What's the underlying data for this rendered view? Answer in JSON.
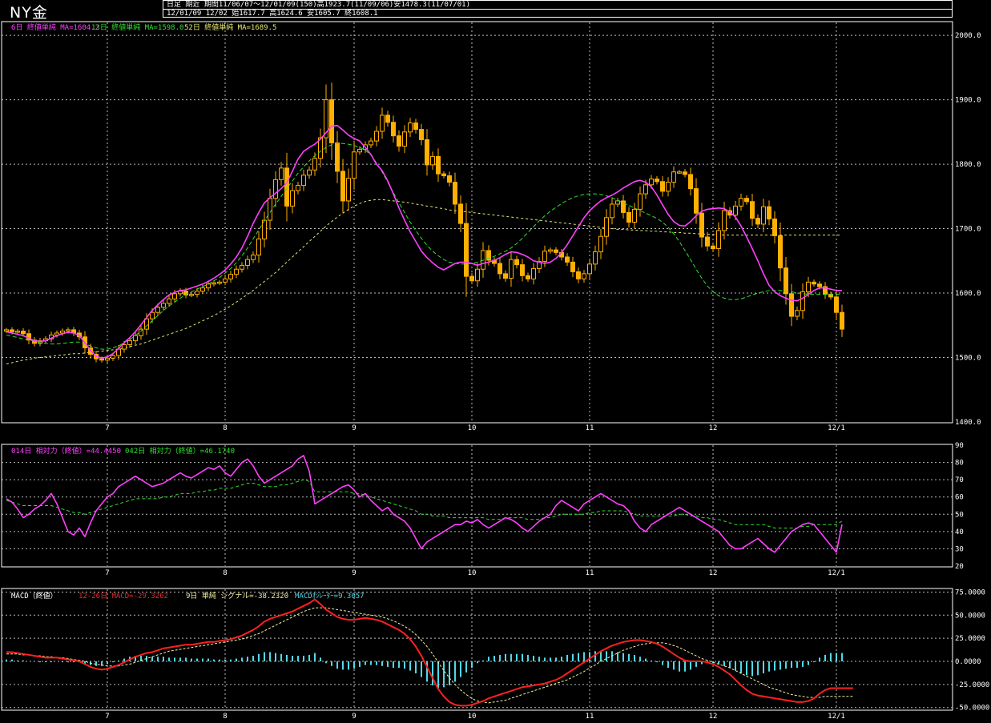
{
  "title": "NY金",
  "header": {
    "line1": "日足 期近 期間11/06/07～12/01/09(150)高1923.7(11/09/06)安1478.3(11/07/01)",
    "line2": "12/01/09 12/02 始1617.7 高1624.6 安1605.7 終1608.1"
  },
  "colors": {
    "background": "#000000",
    "grid": "#bbbbbb",
    "candle": "#ffb000",
    "ma6": "#ff40ff",
    "ma13": "#30e030",
    "ma52": "#e8e870",
    "rsi14": "#ff40ff",
    "rsi42": "#30e030",
    "macd": "#ff2020",
    "signal": "#f0f0a0",
    "osc": "#50d8e8",
    "text": "#ffffff"
  },
  "chart_data": [
    {
      "type": "candlestick",
      "legend": {
        "ma6": "6日 終値単純 MA=1604.2",
        "ma13": "13日 終値単純 MA=1598.0",
        "ma52": "52日 終値単純 MA=1689.5"
      },
      "ylim": [
        1400,
        2020
      ],
      "yticks": [
        1400,
        1500,
        1600,
        1700,
        1800,
        1900,
        2000
      ],
      "ytick_labels": [
        "1400.0",
        "1500.0",
        "1600.0",
        "1700.0",
        "1800.0",
        "1900.0",
        "2000.0"
      ],
      "x_count": 150,
      "xticks": [
        {
          "index": 18,
          "label": "7"
        },
        {
          "index": 39,
          "label": "8"
        },
        {
          "index": 62,
          "label": "9"
        },
        {
          "index": 83,
          "label": "10"
        },
        {
          "index": 104,
          "label": "11"
        },
        {
          "index": 126,
          "label": "12"
        },
        {
          "index": 148,
          "label": "12/1"
        }
      ],
      "close": [
        1543,
        1540,
        1541,
        1537,
        1527,
        1522,
        1526,
        1529,
        1535,
        1538,
        1541,
        1543,
        1538,
        1532,
        1515,
        1505,
        1498,
        1496,
        1499,
        1503,
        1513,
        1520,
        1526,
        1534,
        1544,
        1560,
        1570,
        1578,
        1584,
        1591,
        1599,
        1603,
        1597,
        1598,
        1603,
        1608,
        1614,
        1616,
        1617,
        1622,
        1629,
        1637,
        1643,
        1652,
        1659,
        1684,
        1713,
        1747,
        1776,
        1794,
        1735,
        1759,
        1767,
        1783,
        1791,
        1809,
        1841,
        1900,
        1833,
        1789,
        1743,
        1778,
        1819,
        1823,
        1830,
        1836,
        1851,
        1876,
        1865,
        1844,
        1828,
        1850,
        1864,
        1854,
        1838,
        1799,
        1812,
        1785,
        1782,
        1772,
        1738,
        1708,
        1626,
        1619,
        1637,
        1666,
        1651,
        1646,
        1630,
        1623,
        1652,
        1644,
        1627,
        1622,
        1638,
        1649,
        1665,
        1667,
        1663,
        1656,
        1648,
        1633,
        1622,
        1630,
        1645,
        1664,
        1688,
        1717,
        1738,
        1743,
        1725,
        1710,
        1730,
        1754,
        1768,
        1777,
        1773,
        1758,
        1772,
        1788,
        1788,
        1784,
        1762,
        1724,
        1687,
        1673,
        1669,
        1697,
        1728,
        1721,
        1735,
        1747,
        1742,
        1716,
        1707,
        1734,
        1715,
        1689,
        1639,
        1599,
        1564,
        1573,
        1602,
        1617,
        1614,
        1610,
        1598,
        1594,
        1570,
        1544
      ],
      "ma6": [
        1540,
        1538,
        1536,
        1534,
        1530,
        1526,
        1525,
        1526,
        1530,
        1534,
        1537,
        1539,
        1538,
        1534,
        1523,
        1511,
        1502,
        1499,
        1501,
        1506,
        1514,
        1523,
        1531,
        1540,
        1551,
        1562,
        1573,
        1582,
        1590,
        1597,
        1601,
        1604,
        1605,
        1608,
        1611,
        1614,
        1618,
        1623,
        1629,
        1636,
        1645,
        1656,
        1670,
        1688,
        1708,
        1725,
        1740,
        1748,
        1755,
        1762,
        1771,
        1789,
        1808,
        1820,
        1826,
        1831,
        1839,
        1849,
        1859,
        1860,
        1853,
        1845,
        1840,
        1836,
        1826,
        1815,
        1800,
        1790,
        1774,
        1754,
        1732,
        1713,
        1695,
        1680,
        1665,
        1655,
        1647,
        1640,
        1636,
        1641,
        1646,
        1648,
        1648,
        1646,
        1643,
        1646,
        1648,
        1651,
        1655,
        1660,
        1664,
        1663,
        1660,
        1656,
        1650,
        1648,
        1646,
        1648,
        1654,
        1663,
        1675,
        1689,
        1703,
        1717,
        1728,
        1736,
        1743,
        1748,
        1752,
        1757,
        1763,
        1768,
        1773,
        1775,
        1772,
        1765,
        1752,
        1737,
        1722,
        1711,
        1705,
        1704,
        1711,
        1720,
        1727,
        1730,
        1731,
        1732,
        1731,
        1726,
        1718,
        1704,
        1687,
        1669,
        1650,
        1630,
        1612,
        1602,
        1596,
        1592,
        1589,
        1588,
        1592,
        1598,
        1604,
        1608,
        1608,
        1606,
        1604,
        1604
      ],
      "ma13": [
        1535,
        1533,
        1531,
        1529,
        1527,
        1525,
        1523,
        1522,
        1521,
        1521,
        1522,
        1523,
        1524,
        1524,
        1521,
        1518,
        1515,
        1513,
        1513,
        1515,
        1518,
        1523,
        1528,
        1534,
        1541,
        1549,
        1557,
        1565,
        1573,
        1580,
        1586,
        1592,
        1598,
        1602,
        1606,
        1610,
        1614,
        1619,
        1624,
        1631,
        1638,
        1647,
        1658,
        1670,
        1684,
        1698,
        1712,
        1725,
        1738,
        1750,
        1762,
        1774,
        1786,
        1796,
        1805,
        1813,
        1820,
        1826,
        1830,
        1832,
        1832,
        1831,
        1829,
        1826,
        1822,
        1814,
        1802,
        1788,
        1772,
        1756,
        1740,
        1725,
        1710,
        1697,
        1685,
        1674,
        1665,
        1658,
        1652,
        1648,
        1646,
        1645,
        1645,
        1646,
        1648,
        1651,
        1654,
        1657,
        1661,
        1665,
        1670,
        1677,
        1685,
        1694,
        1703,
        1712,
        1720,
        1727,
        1733,
        1739,
        1744,
        1748,
        1751,
        1753,
        1754,
        1754,
        1753,
        1751,
        1748,
        1744,
        1740,
        1736,
        1732,
        1728,
        1724,
        1720,
        1716,
        1710,
        1702,
        1692,
        1680,
        1666,
        1652,
        1637,
        1623,
        1611,
        1602,
        1596,
        1592,
        1590,
        1590,
        1591,
        1594,
        1597,
        1600,
        1602,
        1604,
        1604,
        1604,
        1603,
        1602,
        1600,
        1599,
        1598,
        1598,
        1598,
        1598,
        1598,
        1598,
        1598
      ],
      "ma52": [
        1490,
        1492,
        1494,
        1496,
        1497,
        1499,
        1500,
        1501,
        1502,
        1503,
        1504,
        1505,
        1506,
        1506,
        1507,
        1508,
        1509,
        1510,
        1511,
        1512,
        1513,
        1515,
        1517,
        1519,
        1521,
        1524,
        1527,
        1530,
        1533,
        1536,
        1539,
        1542,
        1545,
        1549,
        1553,
        1557,
        1561,
        1565,
        1570,
        1575,
        1580,
        1586,
        1592,
        1598,
        1604,
        1611,
        1618,
        1625,
        1632,
        1640,
        1648,
        1656,
        1664,
        1672,
        1680,
        1688,
        1696,
        1704,
        1711,
        1718,
        1724,
        1730,
        1735,
        1739,
        1742,
        1744,
        1745,
        1745,
        1744,
        1743,
        1742,
        1741,
        1740,
        1738,
        1737,
        1735,
        1734,
        1732,
        1731,
        1729,
        1728,
        1727,
        1726,
        1725,
        1724,
        1723,
        1722,
        1721,
        1720,
        1719,
        1718,
        1717,
        1716,
        1715,
        1714,
        1713,
        1712,
        1711,
        1710,
        1709,
        1708,
        1707,
        1706,
        1705,
        1704,
        1703,
        1702,
        1701,
        1700,
        1699,
        1699,
        1698,
        1698,
        1697,
        1697,
        1696,
        1696,
        1695,
        1695,
        1694,
        1694,
        1693,
        1693,
        1692,
        1692,
        1691,
        1691,
        1690,
        1690,
        1690,
        1690,
        1690,
        1690,
        1690,
        1690,
        1690,
        1690,
        1690,
        1690,
        1690,
        1690,
        1690,
        1690,
        1690,
        1690,
        1690,
        1690,
        1690,
        1690,
        1690
      ]
    },
    {
      "type": "line",
      "legend": {
        "rsi14": "014日 相対力（終値）=44.4450",
        "rsi42": "042日 相対力（終値）=46.1740"
      },
      "ylim": [
        20,
        90
      ],
      "yticks": [
        20,
        30,
        40,
        50,
        60,
        70,
        80,
        90
      ],
      "ytick_labels": [
        "20",
        "30",
        "40",
        "50",
        "60",
        "70",
        "80",
        "90"
      ],
      "rsi14": [
        59,
        57,
        53,
        48,
        50,
        53,
        55,
        58,
        62,
        56,
        48,
        40,
        38,
        42,
        37,
        45,
        52,
        56,
        60,
        62,
        66,
        68,
        70,
        72,
        70,
        68,
        66,
        67,
        68,
        70,
        72,
        74,
        72,
        71,
        73,
        75,
        77,
        76,
        78,
        74,
        72,
        76,
        80,
        82,
        78,
        72,
        68,
        70,
        72,
        74,
        76,
        78,
        82,
        84,
        75,
        56,
        58,
        60,
        62,
        64,
        66,
        67,
        64,
        60,
        62,
        58,
        55,
        52,
        54,
        50,
        48,
        46,
        42,
        36,
        30,
        34,
        36,
        38,
        40,
        42,
        44,
        44,
        46,
        45,
        47,
        44,
        42,
        44,
        46,
        48,
        47,
        45,
        42,
        40,
        43,
        46,
        48,
        50,
        55,
        58,
        56,
        54,
        52,
        56,
        58,
        60,
        62,
        60,
        58,
        56,
        55,
        52,
        46,
        42,
        40,
        44,
        46,
        48,
        50,
        52,
        54,
        52,
        50,
        48,
        46,
        44,
        42,
        40,
        36,
        32,
        30,
        30,
        32,
        34,
        36,
        33,
        30,
        28,
        32,
        36,
        40,
        42,
        44,
        45,
        44,
        40,
        36,
        32,
        28,
        44
      ],
      "rsi42": [
        58,
        57,
        56,
        55,
        55,
        55,
        55,
        55,
        55,
        54,
        53,
        52,
        51,
        51,
        50,
        51,
        52,
        53,
        54,
        55,
        56,
        57,
        58,
        59,
        59,
        59,
        59,
        59,
        60,
        60,
        61,
        62,
        62,
        62,
        63,
        63,
        64,
        64,
        65,
        65,
        65,
        66,
        67,
        68,
        68,
        67,
        66,
        66,
        66,
        67,
        67,
        68,
        69,
        70,
        69,
        63,
        63,
        63,
        63,
        63,
        63,
        63,
        62,
        62,
        61,
        60,
        59,
        58,
        57,
        56,
        55,
        54,
        53,
        52,
        50,
        50,
        49,
        49,
        49,
        48,
        48,
        48,
        48,
        48,
        48,
        48,
        47,
        47,
        47,
        48,
        48,
        48,
        48,
        47,
        47,
        47,
        48,
        48,
        49,
        50,
        50,
        50,
        50,
        50,
        51,
        51,
        52,
        52,
        52,
        52,
        52,
        51,
        50,
        49,
        49,
        49,
        49,
        49,
        49,
        49,
        50,
        50,
        49,
        49,
        48,
        48,
        47,
        47,
        46,
        45,
        44,
        44,
        44,
        44,
        44,
        44,
        43,
        42,
        42,
        42,
        42,
        42,
        43,
        43,
        44,
        44,
        44,
        44,
        44,
        46
      ]
    },
    {
      "type": "line+bar",
      "legend": {
        "macd_prefix": "MACD（終値）",
        "macd": "12-26日 MACD=-29.3262",
        "signal": "9日 単純 シグナル=-38.2320",
        "osc": "MACDｵｼﾚｰﾀｰ=9.3057"
      },
      "ylim": [
        -52,
        78
      ],
      "yticks": [
        -50,
        -25,
        0,
        25,
        50,
        75
      ],
      "ytick_labels": [
        "-50.0000",
        "-25.0000",
        "0.0000",
        "25.0000",
        "50.0000",
        "75.0000"
      ],
      "macd": [
        10,
        10,
        9,
        8,
        7,
        6,
        5,
        4,
        4,
        4,
        3,
        2,
        1,
        0,
        -3,
        -6,
        -8,
        -9,
        -8,
        -6,
        -4,
        -1,
        2,
        5,
        7,
        9,
        10,
        12,
        14,
        15,
        16,
        17,
        18,
        18,
        19,
        20,
        21,
        21,
        22,
        23,
        24,
        26,
        28,
        31,
        34,
        38,
        43,
        46,
        48,
        50,
        52,
        54,
        57,
        60,
        63,
        67,
        62,
        56,
        52,
        48,
        46,
        45,
        45,
        46,
        47,
        46,
        45,
        43,
        40,
        37,
        34,
        30,
        24,
        16,
        6,
        -6,
        -18,
        -30,
        -38,
        -44,
        -47,
        -48,
        -48,
        -47,
        -45,
        -43,
        -40,
        -38,
        -36,
        -34,
        -32,
        -30,
        -28,
        -27,
        -26,
        -25,
        -24,
        -22,
        -20,
        -17,
        -13,
        -9,
        -5,
        -1,
        3,
        7,
        11,
        14,
        17,
        19,
        21,
        22,
        23,
        23,
        22,
        21,
        19,
        16,
        12,
        8,
        4,
        1,
        0,
        0,
        0,
        -1,
        -3,
        -6,
        -10,
        -14,
        -20,
        -26,
        -31,
        -35,
        -37,
        -38,
        -39,
        -40,
        -41,
        -42,
        -43,
        -44,
        -44,
        -43,
        -40,
        -35,
        -31,
        -29,
        -29,
        -29,
        -29,
        -29
      ],
      "signal": [
        8,
        8,
        8,
        7,
        7,
        6,
        6,
        5,
        5,
        4,
        4,
        3,
        2,
        1,
        0,
        -2,
        -3,
        -4,
        -5,
        -5,
        -5,
        -4,
        -3,
        -1,
        1,
        3,
        5,
        7,
        9,
        11,
        12,
        13,
        14,
        15,
        16,
        17,
        18,
        19,
        20,
        21,
        22,
        23,
        24,
        26,
        28,
        30,
        33,
        36,
        39,
        42,
        45,
        48,
        51,
        54,
        56,
        58,
        58,
        58,
        57,
        56,
        55,
        54,
        53,
        52,
        51,
        50,
        49,
        48,
        46,
        44,
        41,
        38,
        34,
        29,
        23,
        16,
        8,
        -1,
        -10,
        -18,
        -25,
        -31,
        -36,
        -40,
        -43,
        -44,
        -45,
        -44,
        -43,
        -42,
        -40,
        -38,
        -36,
        -34,
        -32,
        -30,
        -28,
        -26,
        -24,
        -22,
        -20,
        -17,
        -14,
        -11,
        -7,
        -4,
        0,
        3,
        6,
        9,
        12,
        14,
        16,
        18,
        19,
        20,
        20,
        20,
        19,
        17,
        15,
        12,
        9,
        6,
        3,
        1,
        -1,
        -3,
        -5,
        -7,
        -10,
        -13,
        -16,
        -19,
        -22,
        -25,
        -28,
        -30,
        -32,
        -34,
        -36,
        -37,
        -38,
        -39,
        -39,
        -39,
        -38,
        -38,
        -38,
        -38,
        -38,
        -38
      ]
    }
  ]
}
